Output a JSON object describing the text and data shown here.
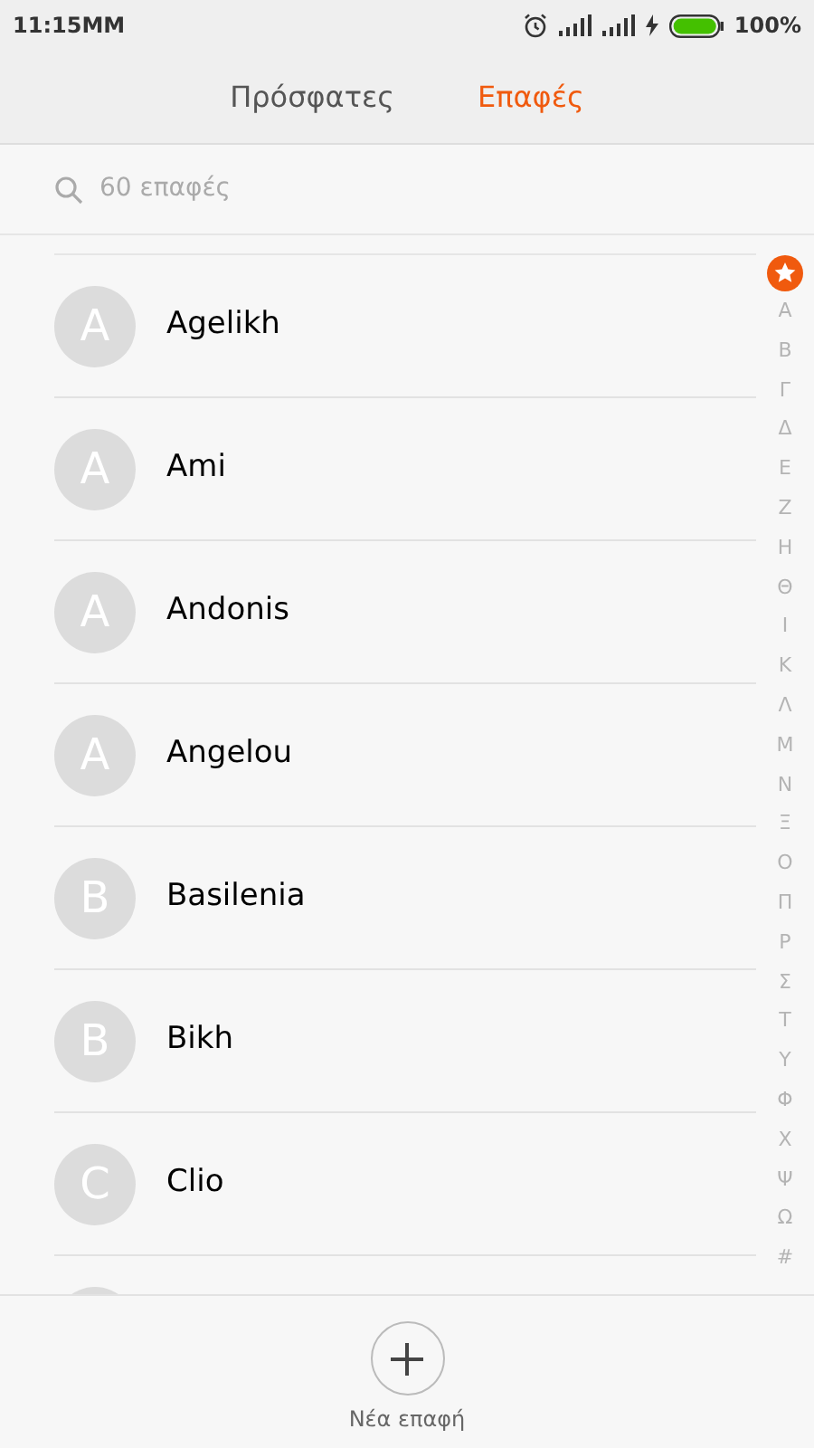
{
  "status_bar": {
    "time": "11:15MM",
    "battery": "100%"
  },
  "tabs": [
    {
      "label": "Πρόσφατες",
      "selected": false
    },
    {
      "label": "Επαφές",
      "selected": true
    }
  ],
  "search": {
    "placeholder": "60 επαφές"
  },
  "contacts": [
    {
      "initial": "A",
      "name": "Agelikh"
    },
    {
      "initial": "A",
      "name": "Ami"
    },
    {
      "initial": "A",
      "name": "Andonis"
    },
    {
      "initial": "A",
      "name": "Angelou"
    },
    {
      "initial": "B",
      "name": "Basilenia"
    },
    {
      "initial": "B",
      "name": "Bikh"
    },
    {
      "initial": "C",
      "name": "Clio"
    }
  ],
  "index": [
    "A",
    "B",
    "Γ",
    "Δ",
    "Ε",
    "Ζ",
    "Η",
    "Θ",
    "Ι",
    "Κ",
    "Λ",
    "Μ",
    "Ν",
    "Ξ",
    "Ο",
    "Π",
    "Ρ",
    "Σ",
    "Τ",
    "Υ",
    "Φ",
    "Χ",
    "Ψ",
    "Ω",
    "#"
  ],
  "new_contact": {
    "label": "Νέα επαφή"
  }
}
